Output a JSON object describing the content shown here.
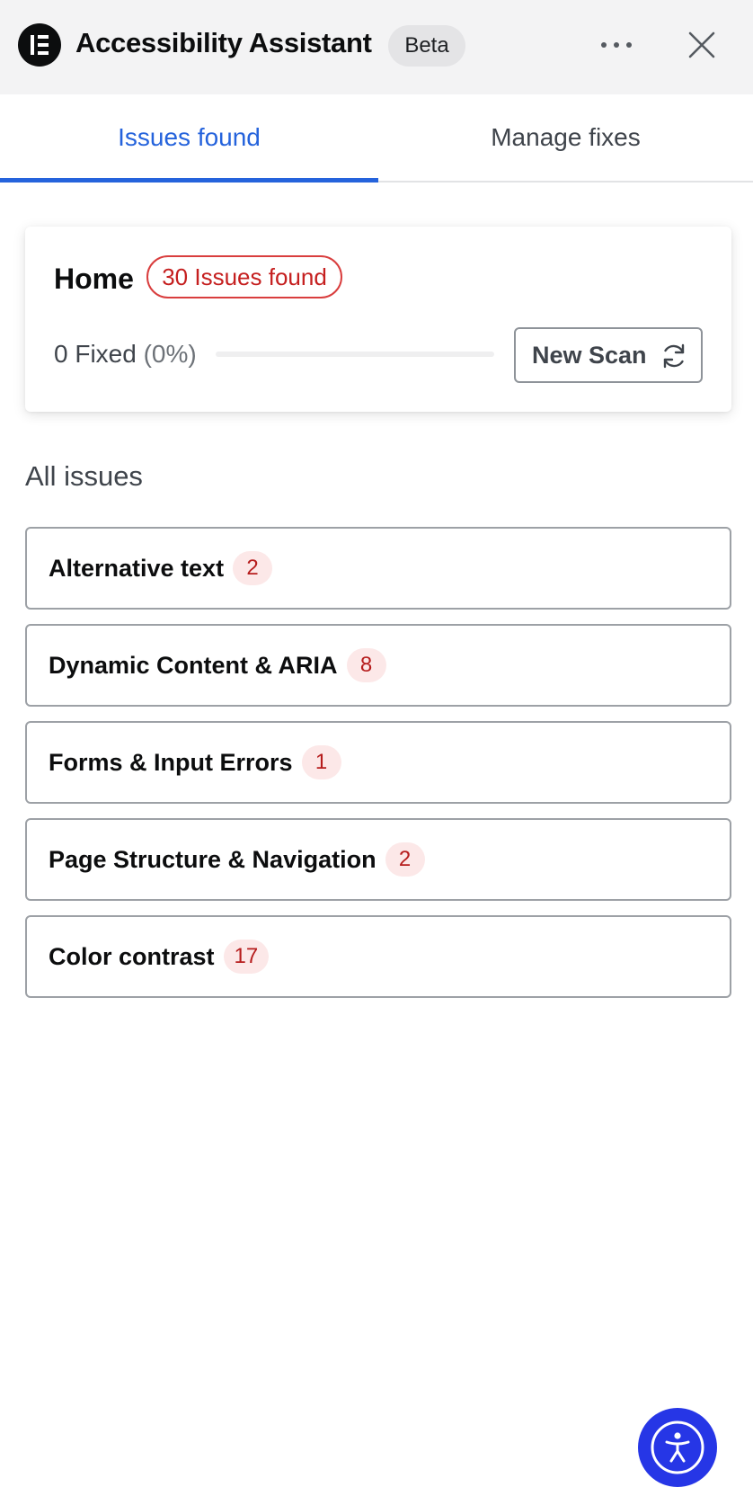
{
  "header": {
    "title": "Accessibility Assistant",
    "badge": "Beta",
    "icons": {
      "logo": "elementor-logo-icon",
      "more": "more-horizontal-icon",
      "close": "close-icon"
    }
  },
  "tabs": [
    {
      "label": "Issues found",
      "active": true
    },
    {
      "label": "Manage fixes",
      "active": false
    }
  ],
  "summary": {
    "page_name": "Home",
    "issues_chip": "30 Issues found",
    "fixed_label": "0 Fixed",
    "fixed_pct": "(0%)",
    "progress_fraction": 0,
    "new_scan_label": "New Scan",
    "refresh_icon": "refresh-icon"
  },
  "all_issues": {
    "title": "All issues",
    "items": [
      {
        "label": "Alternative text",
        "count": "2"
      },
      {
        "label": "Dynamic Content & ARIA",
        "count": "8"
      },
      {
        "label": "Forms & Input Errors",
        "count": "1"
      },
      {
        "label": "Page Structure & Navigation",
        "count": "2"
      },
      {
        "label": "Color contrast",
        "count": "17"
      }
    ]
  },
  "fab": {
    "icon": "accessibility-icon"
  },
  "colors": {
    "accent": "#2563dc",
    "error": "#c51f1f",
    "error_bg": "#fce8e8",
    "fab": "#2636e6",
    "header_bg": "#f3f3f4"
  }
}
